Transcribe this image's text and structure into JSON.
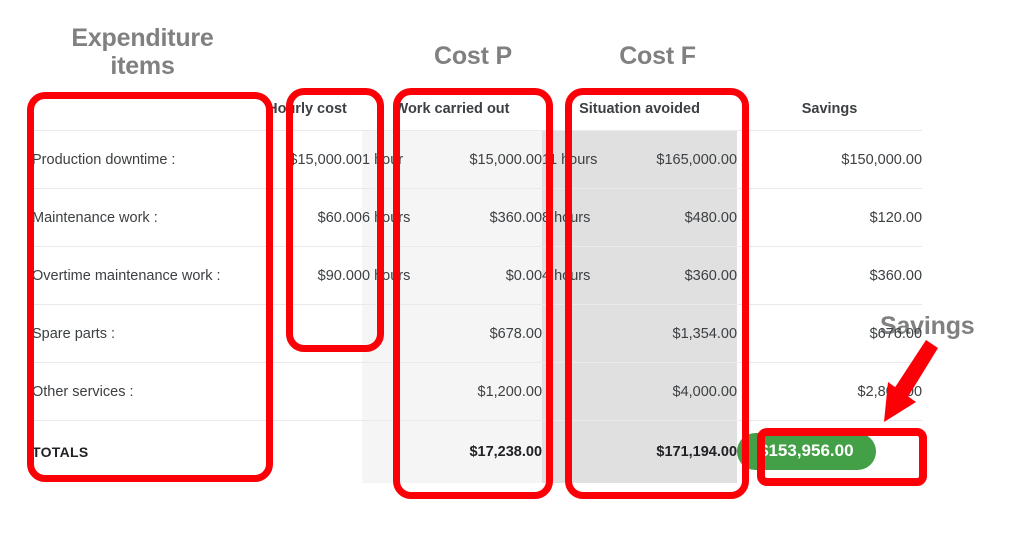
{
  "annotations": {
    "expenditure_title": "Expenditure\nitems",
    "cost_p_title": "Cost P",
    "cost_f_title": "Cost F",
    "savings_title": "Savings",
    "highlight_color": "#fb0007",
    "title_color": "#808080"
  },
  "table": {
    "headers": {
      "item": "",
      "hourly_cost": "Hourly cost",
      "work_carried_out": "Work carried out",
      "situation_avoided": "Situation avoided",
      "savings": "Savings"
    },
    "rows": [
      {
        "item": "Production downtime :",
        "hourly_cost": "$15,000.00",
        "p_hours": "1 hour",
        "p_cost": "$15,000.00",
        "f_hours": "11 hours",
        "f_cost": "$165,000.00",
        "savings": "$150,000.00"
      },
      {
        "item": "Maintenance work :",
        "hourly_cost": "$60.00",
        "p_hours": "6 hours",
        "p_cost": "$360.00",
        "f_hours": "8 hours",
        "f_cost": "$480.00",
        "savings": "$120.00"
      },
      {
        "item": "Overtime maintenance work :",
        "hourly_cost": "$90.00",
        "p_hours": "0 hours",
        "p_cost": "$0.00",
        "f_hours": "4 hours",
        "f_cost": "$360.00",
        "savings": "$360.00"
      },
      {
        "item": "Spare parts :",
        "hourly_cost": "",
        "p_hours": "",
        "p_cost": "$678.00",
        "f_hours": "",
        "f_cost": "$1,354.00",
        "savings": "$676.00"
      },
      {
        "item": "Other services :",
        "hourly_cost": "",
        "p_hours": "",
        "p_cost": "$1,200.00",
        "f_hours": "",
        "f_cost": "$4,000.00",
        "savings": "$2,800.00"
      }
    ],
    "totals": {
      "item": "TOTALS",
      "hourly_cost": "",
      "p_hours": "",
      "p_cost": "$17,238.00",
      "f_hours": "",
      "f_cost": "$171,194.00",
      "savings": "$153,956.00"
    },
    "colors": {
      "cost_p_bg": "#f5f5f5",
      "cost_f_bg": "#e0e0e0",
      "savings_badge_bg": "#43a047",
      "savings_badge_text": "#ffffff"
    }
  }
}
